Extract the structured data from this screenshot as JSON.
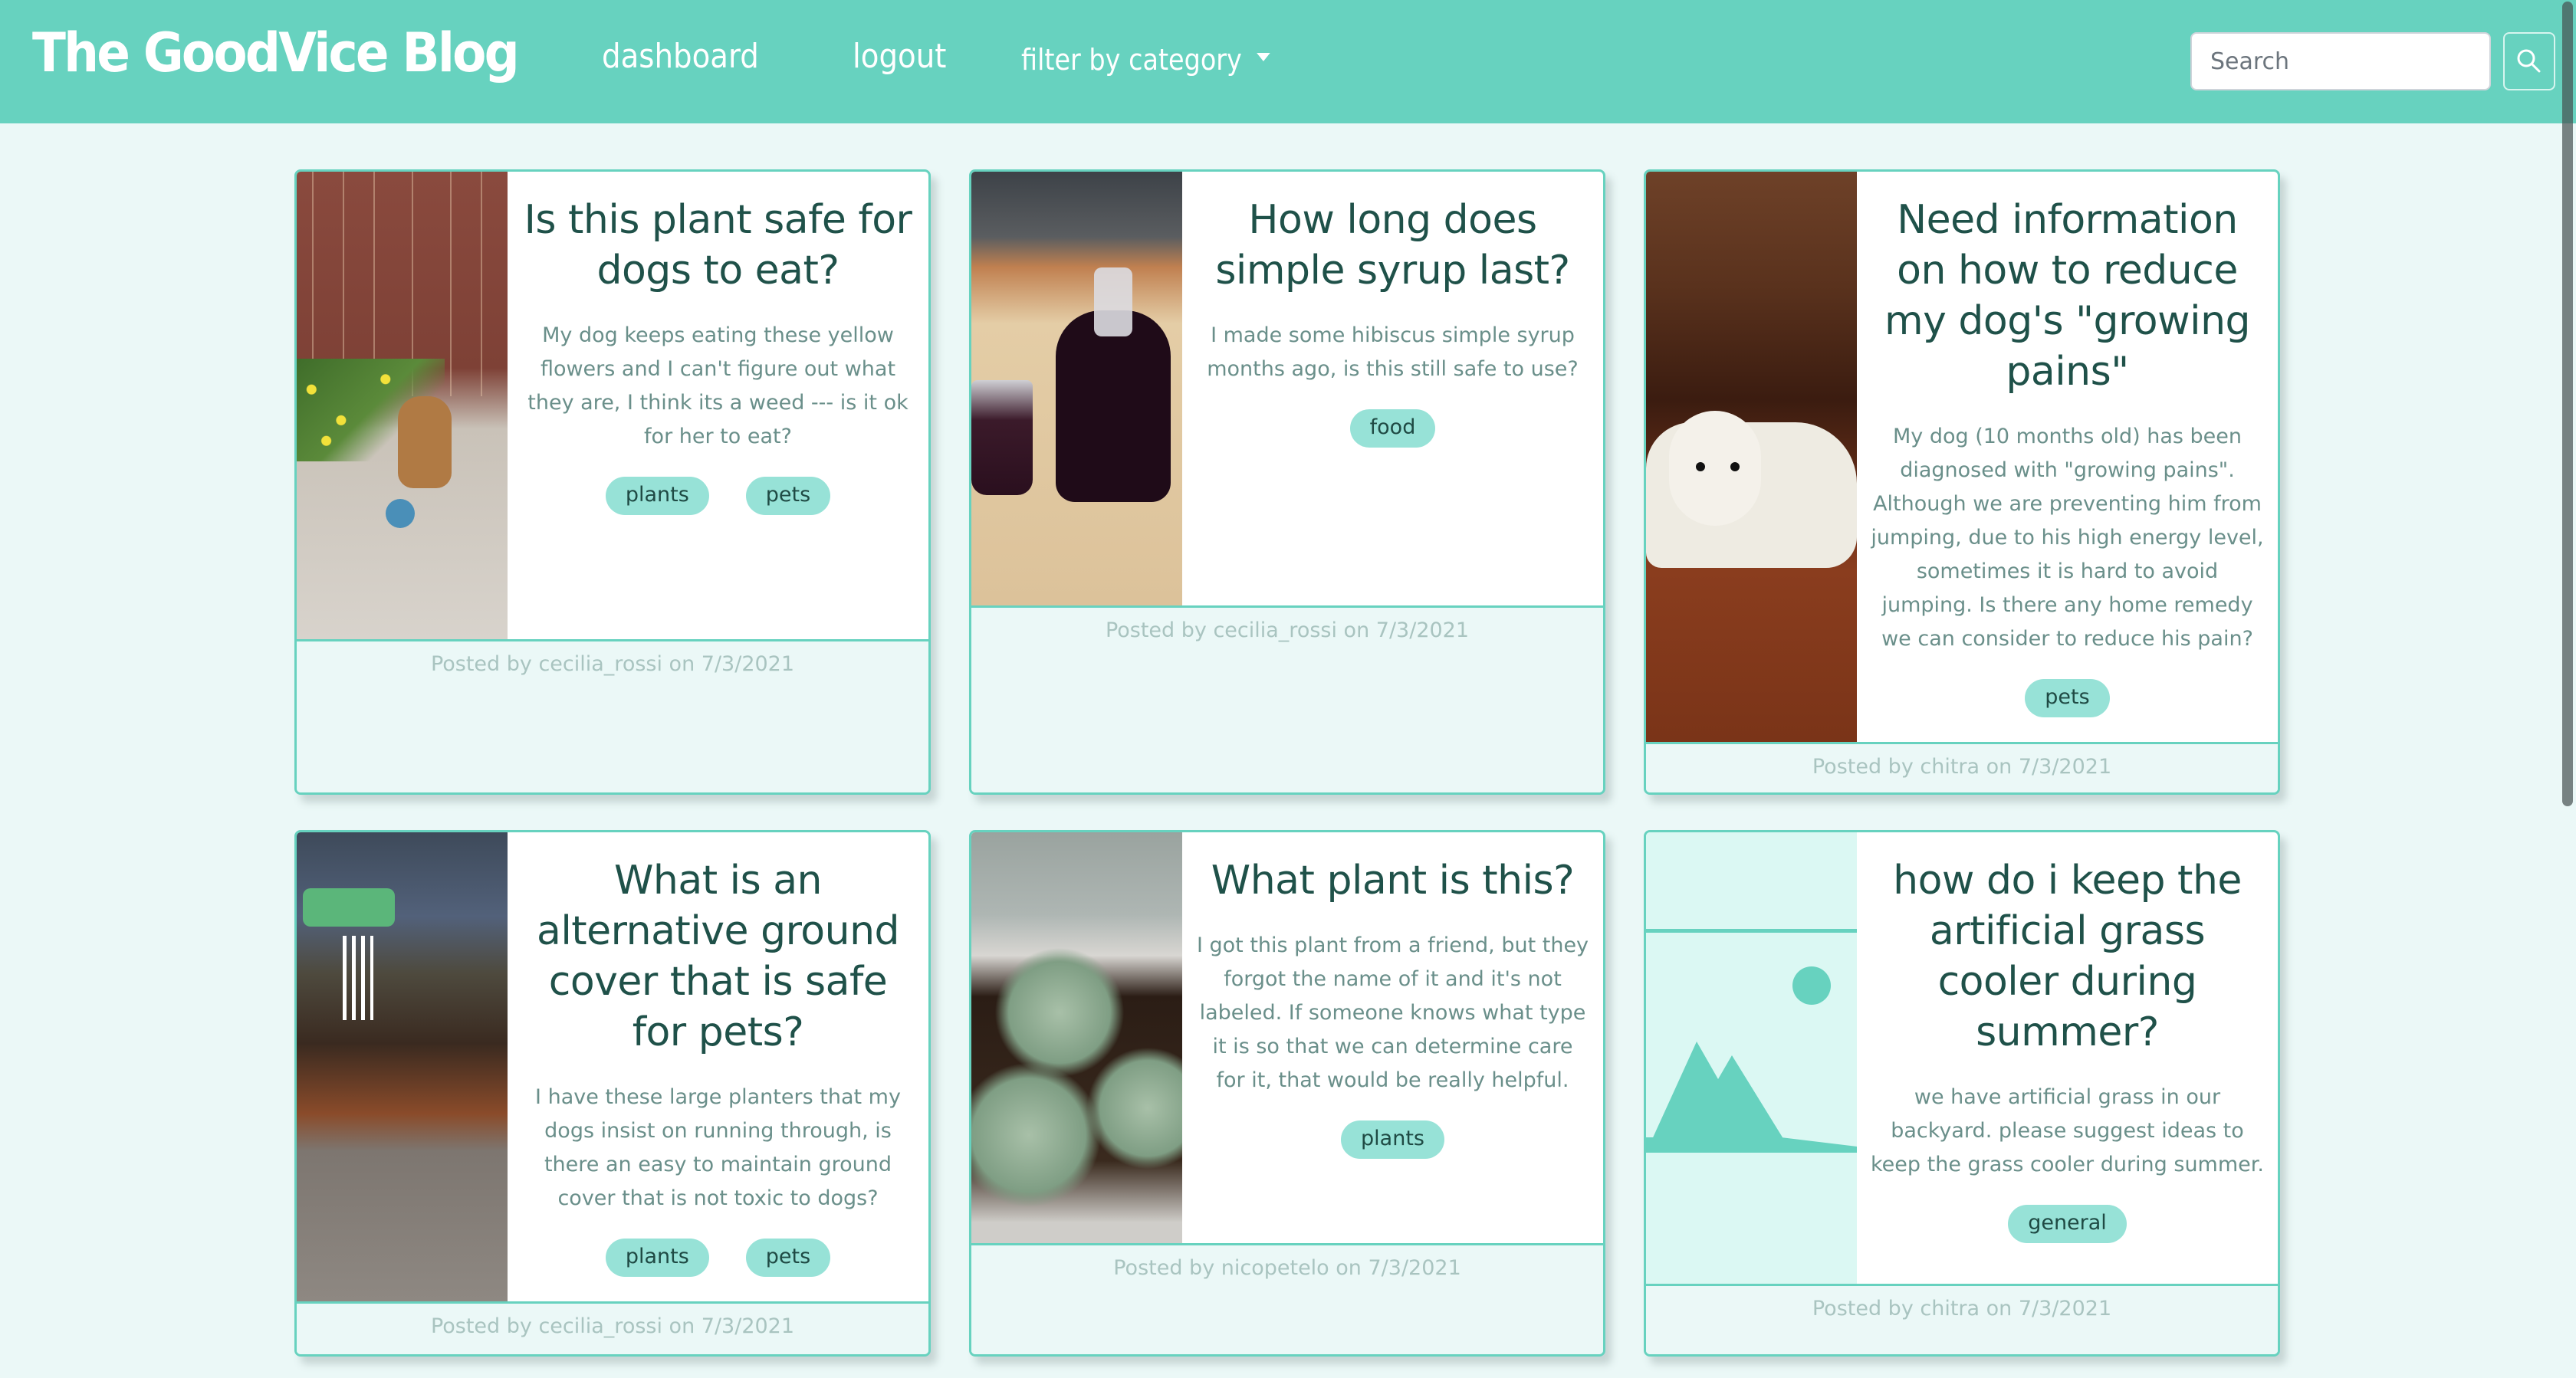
{
  "navbar": {
    "brand": "The GoodVice Blog",
    "links": [
      {
        "label": "dashboard"
      },
      {
        "label": "logout"
      }
    ],
    "filter_label": "filter by category",
    "search": {
      "placeholder": "Search",
      "value": ""
    },
    "search_button_icon": "search-icon"
  },
  "colors": {
    "navbar": "#67d2bf",
    "page_background": "#ebf8f7",
    "title_text": "#1f5149",
    "body_text": "#6a8f8a",
    "tag_background": "#97e2d7",
    "footer_text": "#a9c4c0"
  },
  "posts": [
    {
      "image": "dog in backyard with yellow flowers",
      "title": "Is this plant safe for dogs to eat?",
      "body": "My dog keeps eating these yellow flowers and I can't figure out what they are, I think its a weed --- is it ok for her to eat?",
      "tags": [
        "plants",
        "pets"
      ],
      "footer": "Posted by cecilia_rossi on 7/3/2021"
    },
    {
      "image": "jars of hibiscus syrup",
      "title": "How long does simple syrup last?",
      "body": "I made some hibiscus simple syrup months ago, is this still safe to use?",
      "tags": [
        "food"
      ],
      "footer": "Posted by cecilia_rossi on 7/3/2021"
    },
    {
      "image": "white puppy lying on floor",
      "title": "Need information on how to reduce my dog's \"growing pains\"",
      "body": "My dog (10 months old) has been diagnosed with \"growing pains\". Although we are preventing him from jumping, due to his high energy level, sometimes it is hard to avoid jumping. Is there any home remedy we can consider to reduce his pain?",
      "tags": [
        "pets"
      ],
      "footer": "Posted by chitra on 7/3/2021"
    },
    {
      "image": "backyard garden with planters",
      "title": "What is an alternative ground cover that is safe for pets?",
      "body": "I have these large planters that my dogs insist on running through, is there an easy to maintain ground cover that is not toxic to dogs?",
      "tags": [
        "plants",
        "pets"
      ],
      "footer": "Posted by cecilia_rossi on 7/3/2021"
    },
    {
      "image": "succulents in a pot",
      "title": "What plant is this?",
      "body": "I got this plant from a friend, but they forgot the name of it and it's not labeled. If someone knows what type it is so that we can determine care for it, that would be really helpful.",
      "tags": [
        "plants"
      ],
      "footer": "Posted by nicopetelo on 7/3/2021"
    },
    {
      "image": "placeholder-image-icon",
      "title": "how do i keep the artificial grass cooler during summer?",
      "body": "we have artificial grass in our backyard. please suggest ideas to keep the grass cooler during summer.",
      "tags": [
        "general"
      ],
      "footer": "Posted by chitra on 7/3/2021"
    }
  ]
}
